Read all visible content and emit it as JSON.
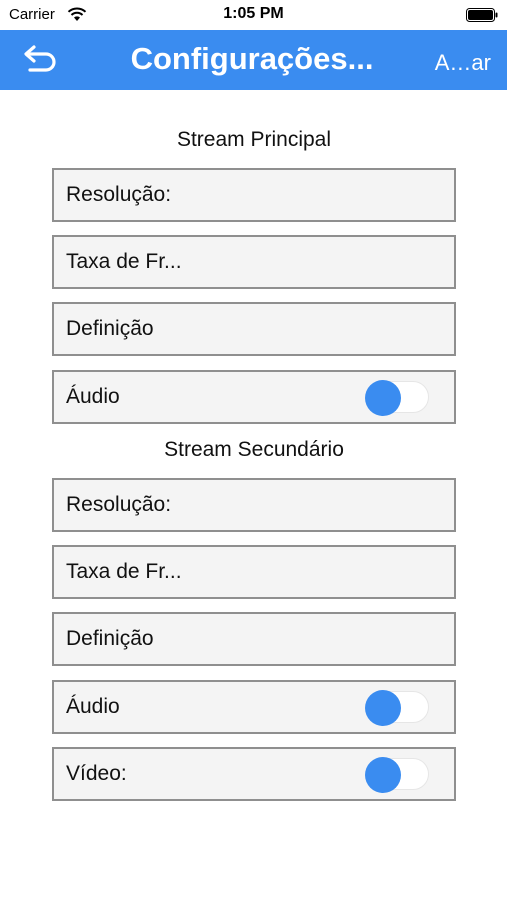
{
  "status_bar": {
    "carrier": "Carrier",
    "time": "1:05 PM",
    "icons": [
      "wifi-icon",
      "battery-icon"
    ]
  },
  "nav": {
    "back_icon": "back-arrow-icon",
    "title": "Configurações...",
    "action": "A…ar",
    "color": "#3a8cf0"
  },
  "main_stream": {
    "title": "Stream Principal",
    "rows": [
      {
        "label": "Resolução:"
      },
      {
        "label": "Taxa de Fr..."
      },
      {
        "label": "Definição"
      },
      {
        "label": "Áudio",
        "toggle": "off"
      }
    ]
  },
  "sub_stream": {
    "title": "Stream Secundário",
    "rows": [
      {
        "label": "Resolução:"
      },
      {
        "label": "Taxa de Fr..."
      },
      {
        "label": "Definição"
      },
      {
        "label": "Áudio",
        "toggle": "off"
      },
      {
        "label": "Vídeo:",
        "toggle": "off"
      }
    ]
  },
  "colors": {
    "accent": "#3a8cf0",
    "row_background": "#f4f4f4",
    "row_border": "#8f8f8f"
  }
}
